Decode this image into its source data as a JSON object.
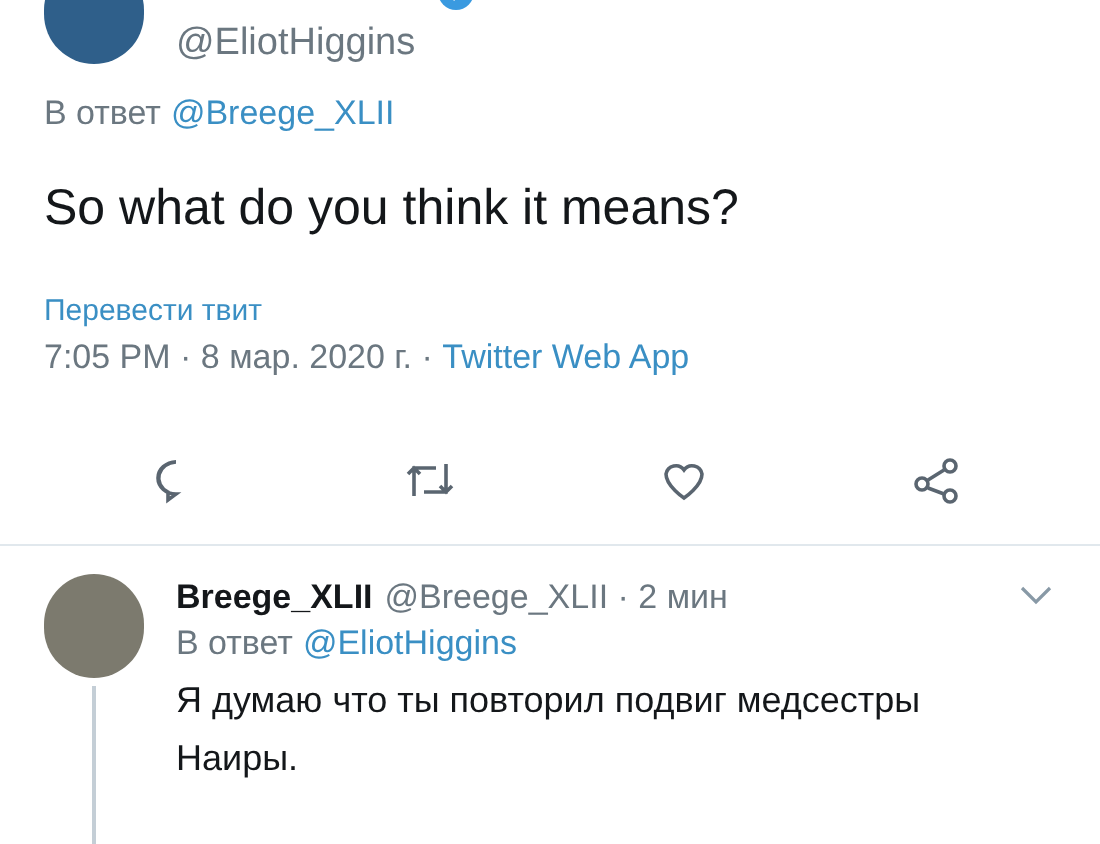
{
  "tweet": {
    "handle": "@EliotHiggins",
    "verified": true,
    "reply_prefix": "В ответ",
    "reply_to": "@Breege_XLII",
    "text": "So what do you think it means?",
    "translate": "Перевести твит",
    "time": "7:05 PM · 8 мар. 2020 г. · ",
    "source": "Twitter Web App"
  },
  "reply": {
    "name": "Breege_XLII",
    "handle": "@Breege_XLII · 2 мин",
    "reply_prefix": "В ответ",
    "reply_to": "@EliotHiggins",
    "text": "Я думаю что ты повторил подвиг медсестры Наиры."
  }
}
